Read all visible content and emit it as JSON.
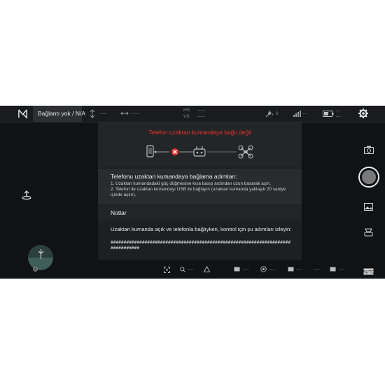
{
  "topbar": {
    "connection_status": "Bağlantı yok / N/A",
    "link_value": "-----",
    "signal_value": "-----",
    "hs_label": "HS",
    "vs_label": "VS",
    "hs_value": "-----",
    "vs_value": "-----",
    "satellite_count": "0",
    "rc_signal_value": "---",
    "battery_value": "---",
    "battery_sub": "---"
  },
  "dialog": {
    "warning_title": "Telefon uzaktan kumandaya bağlı değil",
    "steps_title": "Telefonu uzaktan kumandaya bağlama adımları:",
    "step_1": "1. Uzaktan kumandadaki güç düğmesine kısa basıp ardından uzun basarak açın.",
    "step_2": "2. Telefon ile uzaktan kumandayı USB ile bağlayın (uzaktan kumanda yaklaşık 20 saniye içinde açılır).",
    "notes_title": "Notlar",
    "notes_text": "Uzaktan kumanda açık ve telefonla bağlıyken, kontrol için şu adımları izleyin:",
    "notes_hash": "################################################################################"
  },
  "bottombar": {
    "v1": "----",
    "v2": "----",
    "v3": "----",
    "v4": "----",
    "v5": "----",
    "v6": "----",
    "v7": "----"
  },
  "colors": {
    "warning": "#e8322a",
    "background": "#111214",
    "panel": "#1e1f22"
  }
}
